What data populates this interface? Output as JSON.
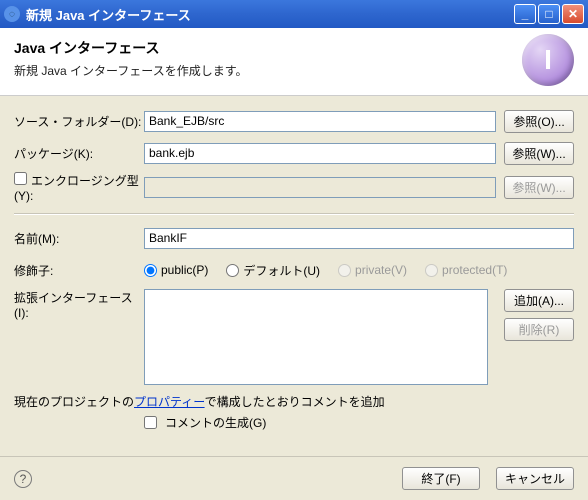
{
  "title": "新規 Java インターフェース",
  "header": {
    "h1": "Java インターフェース",
    "desc": "新規 Java インターフェースを作成します。"
  },
  "labels": {
    "sourceFolder": "ソース・フォルダー(D):",
    "package": "パッケージ(K):",
    "enclosing": "エンクロージング型(Y):",
    "name": "名前(M):",
    "modifiers": "修飾子:",
    "extended": "拡張インターフェース(I):"
  },
  "values": {
    "sourceFolder": "Bank_EJB/src",
    "package": "bank.ejb",
    "enclosing": "",
    "name": "BankIF"
  },
  "buttons": {
    "browseO": "参照(O)...",
    "browseW": "参照(W)...",
    "browseW2": "参照(W)...",
    "addA": "追加(A)...",
    "removeR": "削除(R)",
    "finish": "終了(F)",
    "cancel": "キャンセル"
  },
  "radios": {
    "public": "public(P)",
    "default": "デフォルト(U)",
    "private": "private(V)",
    "protected": "protected(T)"
  },
  "linkrow": {
    "pre": "現在のプロジェクトの",
    "link": "プロパティー",
    "post": "で構成したとおりコメントを追加"
  },
  "genComments": "コメントの生成(G)"
}
